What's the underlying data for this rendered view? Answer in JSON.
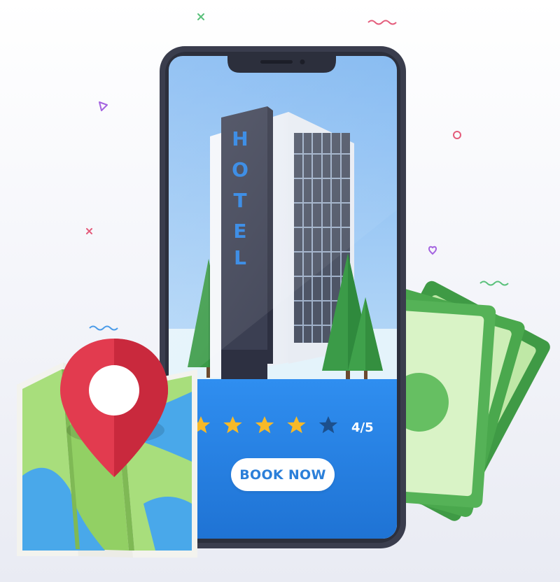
{
  "hotel_sign": [
    "H",
    "O",
    "T",
    "E",
    "L"
  ],
  "rating": {
    "value": 4,
    "max": 5,
    "text": "4/5"
  },
  "book_button": {
    "label": "BOOK NOW"
  },
  "colors": {
    "screen_sky": "#8fc2f4",
    "screen_panel": "#2a86e6",
    "phone_body": "#3a3d4d",
    "star_filled": "#f7b928",
    "star_empty": "#1c4f8c",
    "pin_red": "#e23b4f",
    "map_green": "#a8de7c",
    "map_blue": "#49a8ea",
    "money_green": "#4fa64e"
  },
  "icons": {
    "location": "map-pin-icon",
    "map": "folded-map-icon",
    "money": "banknotes-icon",
    "star": "star-icon"
  }
}
